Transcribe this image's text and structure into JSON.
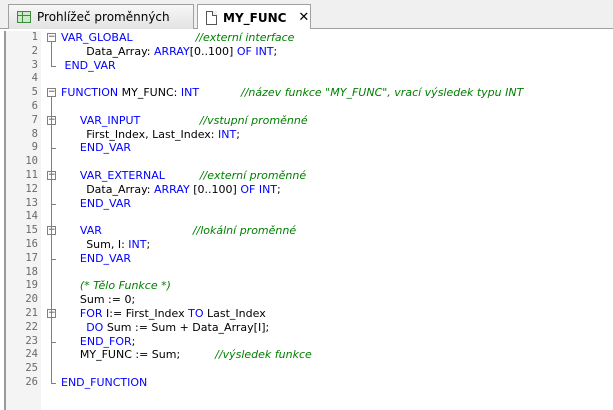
{
  "tabs": [
    {
      "label": "Prohlížeč proměnných",
      "icon": "variable-table-icon",
      "active": false
    },
    {
      "label": "MY_FUNC",
      "icon": "document-icon",
      "active": true,
      "close": "✕"
    }
  ],
  "code": [
    {
      "n": "1",
      "indent": 0,
      "fold": "start",
      "segs": [
        {
          "t": "VAR_GLOBAL",
          "c": "kw"
        },
        {
          "t": "                  "
        },
        {
          "t": "//externí interface",
          "c": "cm"
        }
      ]
    },
    {
      "n": "2",
      "indent": 4,
      "segs": [
        {
          "t": "Data_Array: "
        },
        {
          "t": "ARRAY",
          "c": "kw"
        },
        {
          "t": "[0..100] "
        },
        {
          "t": "OF",
          "c": "kw"
        },
        {
          "t": " "
        },
        {
          "t": "INT",
          "c": "kw"
        },
        {
          "t": ";"
        }
      ]
    },
    {
      "n": "3",
      "indent": 0,
      "fold": "end",
      "segs": [
        {
          "t": " END_VAR",
          "c": "kw"
        }
      ]
    },
    {
      "n": "4",
      "indent": 0,
      "segs": []
    },
    {
      "n": "5",
      "indent": 0,
      "fold": "start",
      "segs": [
        {
          "t": "FUNCTION",
          "c": "kw"
        },
        {
          "t": " MY_FUNC: "
        },
        {
          "t": "INT",
          "c": "kw"
        },
        {
          "t": "            "
        },
        {
          "t": "//název funkce \"MY_FUNC\", vrací výsledek typu INT",
          "c": "cm"
        }
      ]
    },
    {
      "n": "6",
      "indent": 0,
      "fold": "mid",
      "segs": []
    },
    {
      "n": "7",
      "indent": 3,
      "fold": "start",
      "segs": [
        {
          "t": "VAR_INPUT",
          "c": "kw"
        },
        {
          "t": "                 "
        },
        {
          "t": "//vstupní proměnné",
          "c": "cm"
        }
      ]
    },
    {
      "n": "8",
      "indent": 4,
      "fold": "mid",
      "segs": [
        {
          "t": "First_Index, Last_Index: "
        },
        {
          "t": "INT",
          "c": "kw"
        },
        {
          "t": ";"
        }
      ]
    },
    {
      "n": "9",
      "indent": 3,
      "fold": "end",
      "segs": [
        {
          "t": "END_VAR",
          "c": "kw"
        }
      ]
    },
    {
      "n": "10",
      "indent": 0,
      "fold": "mid",
      "segs": []
    },
    {
      "n": "11",
      "indent": 3,
      "fold": "start",
      "segs": [
        {
          "t": "VAR_EXTERNAL",
          "c": "kw"
        },
        {
          "t": "          "
        },
        {
          "t": "//externí proměnné",
          "c": "cm"
        }
      ]
    },
    {
      "n": "12",
      "indent": 4,
      "fold": "mid",
      "segs": [
        {
          "t": "Data_Array: "
        },
        {
          "t": "ARRAY",
          "c": "kw"
        },
        {
          "t": " [0..100] "
        },
        {
          "t": "OF",
          "c": "kw"
        },
        {
          "t": " "
        },
        {
          "t": "INT",
          "c": "kw"
        },
        {
          "t": ";"
        }
      ]
    },
    {
      "n": "13",
      "indent": 3,
      "fold": "end",
      "segs": [
        {
          "t": "END_VAR",
          "c": "kw"
        }
      ]
    },
    {
      "n": "14",
      "indent": 0,
      "fold": "mid",
      "segs": []
    },
    {
      "n": "15",
      "indent": 3,
      "fold": "start",
      "segs": [
        {
          "t": "VAR",
          "c": "kw"
        },
        {
          "t": "                          "
        },
        {
          "t": "//lokální proměnné",
          "c": "cm"
        }
      ]
    },
    {
      "n": "16",
      "indent": 4,
      "fold": "mid",
      "segs": [
        {
          "t": "Sum, I: "
        },
        {
          "t": "INT",
          "c": "kw"
        },
        {
          "t": ";"
        }
      ]
    },
    {
      "n": "17",
      "indent": 3,
      "fold": "end",
      "segs": [
        {
          "t": "END_VAR",
          "c": "kw"
        }
      ]
    },
    {
      "n": "18",
      "indent": 0,
      "fold": "mid",
      "segs": []
    },
    {
      "n": "19",
      "indent": 3,
      "fold": "mid",
      "segs": [
        {
          "t": "(* Tělo Funkce *)",
          "c": "cm"
        }
      ]
    },
    {
      "n": "20",
      "indent": 3,
      "fold": "mid",
      "segs": [
        {
          "t": "Sum := 0;"
        }
      ]
    },
    {
      "n": "21",
      "indent": 3,
      "fold": "start",
      "segs": [
        {
          "t": "FOR",
          "c": "kw"
        },
        {
          "t": " I:= First_Index "
        },
        {
          "t": "TO",
          "c": "kw"
        },
        {
          "t": " Last_Index"
        }
      ]
    },
    {
      "n": "22",
      "indent": 4,
      "fold": "mid",
      "segs": [
        {
          "t": "DO",
          "c": "kw"
        },
        {
          "t": " Sum := Sum + Data_Array[I];"
        }
      ]
    },
    {
      "n": "23",
      "indent": 3,
      "fold": "end",
      "segs": [
        {
          "t": "END_FOR",
          "c": "kw"
        },
        {
          "t": ";"
        }
      ]
    },
    {
      "n": "24",
      "indent": 3,
      "fold": "mid",
      "segs": [
        {
          "t": "MY_FUNC := Sum;"
        },
        {
          "t": "          "
        },
        {
          "t": "//výsledek funkce",
          "c": "cm"
        }
      ]
    },
    {
      "n": "25",
      "indent": 0,
      "fold": "mid",
      "segs": []
    },
    {
      "n": "26",
      "indent": 0,
      "fold": "end",
      "segs": [
        {
          "t": "END_FUNCTION",
          "c": "kw"
        }
      ]
    }
  ],
  "colors": {
    "keyword": "#0000ff",
    "comment": "#008000",
    "text": "#000000",
    "line_number": "#6a6a6a"
  }
}
